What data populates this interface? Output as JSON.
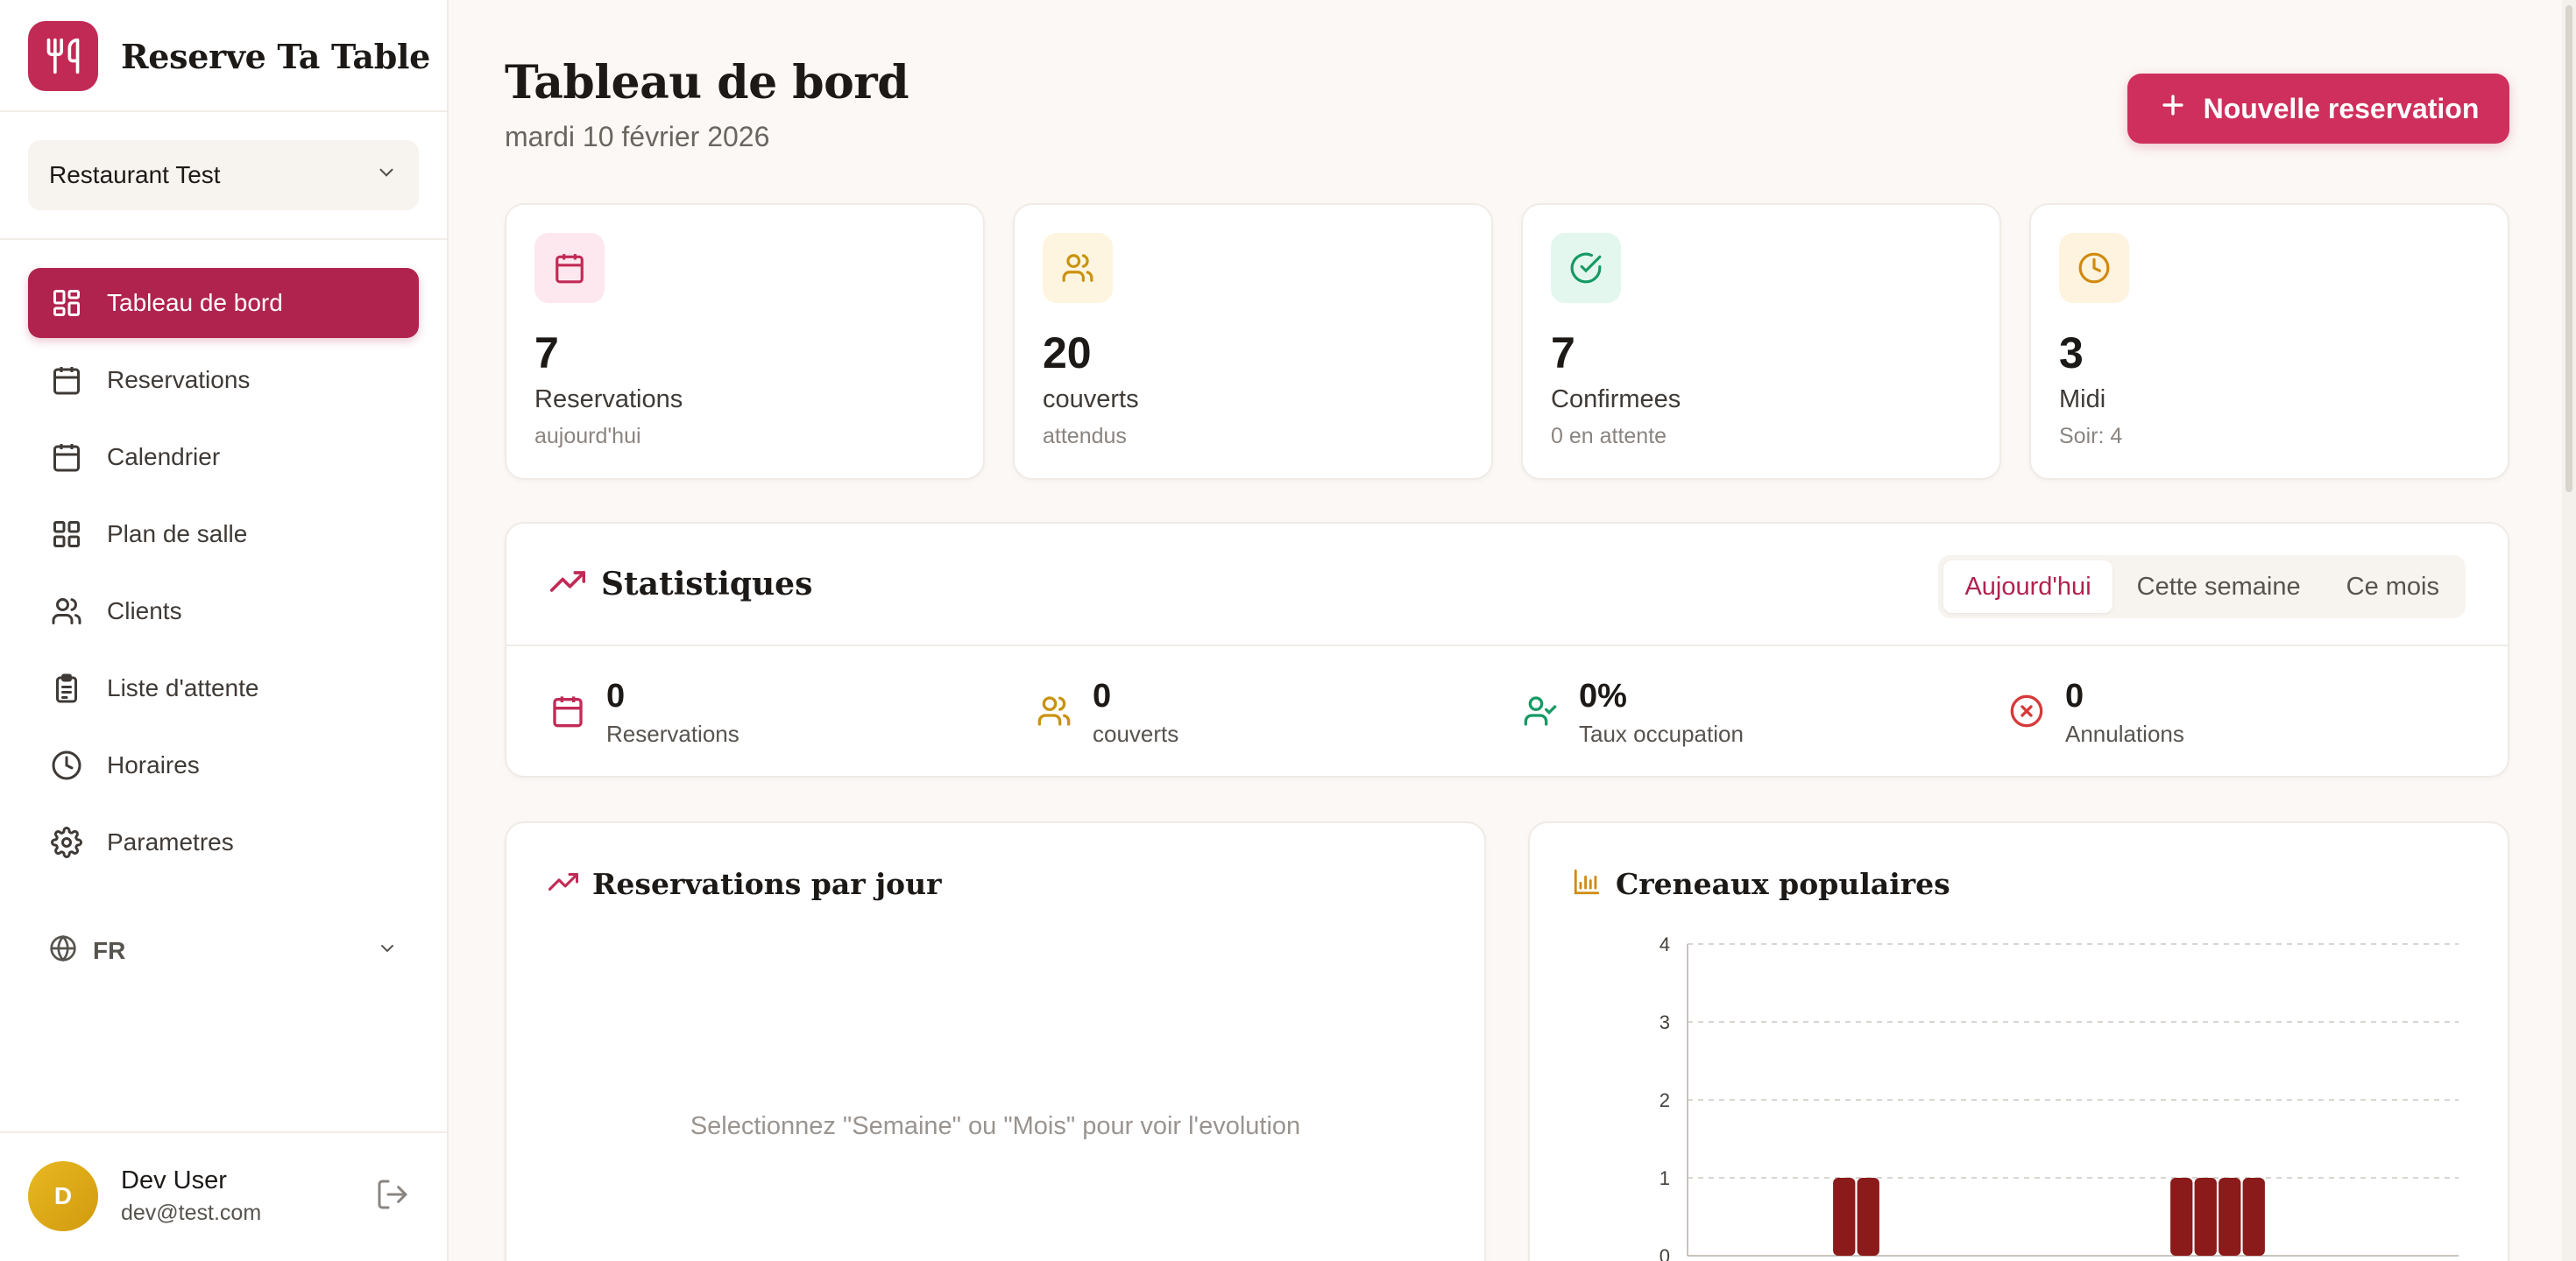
{
  "brand": {
    "name": "Reserve Ta Table"
  },
  "restaurant_select": {
    "value": "Restaurant Test"
  },
  "nav": {
    "items": [
      {
        "label": "Tableau de bord",
        "icon": "dashboard-icon",
        "active": true
      },
      {
        "label": "Reservations",
        "icon": "calendar-icon"
      },
      {
        "label": "Calendrier",
        "icon": "calendar-grid-icon"
      },
      {
        "label": "Plan de salle",
        "icon": "floor-plan-icon"
      },
      {
        "label": "Clients",
        "icon": "users-icon"
      },
      {
        "label": "Liste d'attente",
        "icon": "clipboard-icon"
      },
      {
        "label": "Horaires",
        "icon": "clock-icon"
      },
      {
        "label": "Parametres",
        "icon": "gear-icon"
      }
    ]
  },
  "language": {
    "value": "FR"
  },
  "user": {
    "initial": "D",
    "name": "Dev User",
    "email": "dev@test.com"
  },
  "header": {
    "title": "Tableau de bord",
    "date": "mardi 10 février 2026",
    "new_button": "Nouvelle reservation"
  },
  "kpis": [
    {
      "value": "7",
      "label": "Reservations",
      "sub": "aujourd'hui",
      "icon": "calendar-icon",
      "color": "#C22A56",
      "bg": "#FCE8EE"
    },
    {
      "value": "20",
      "label": "couverts",
      "sub": "attendus",
      "icon": "users-icon",
      "color": "#C99310",
      "bg": "#FDF5DF"
    },
    {
      "value": "7",
      "label": "Confirmees",
      "sub": "0 en attente",
      "icon": "check-circle-icon",
      "color": "#159A64",
      "bg": "#E3F7EE"
    },
    {
      "value": "3",
      "label": "Midi",
      "sub": "Soir: 4",
      "icon": "clock-icon",
      "color": "#D08A0E",
      "bg": "#FDF3DF"
    }
  ],
  "statistics": {
    "title": "Statistiques",
    "tabs": [
      "Aujourd'hui",
      "Cette semaine",
      "Ce mois"
    ],
    "active_tab": "Aujourd'hui",
    "items": [
      {
        "value": "0",
        "label": "Reservations",
        "icon": "calendar-icon",
        "color": "#C22A56"
      },
      {
        "value": "0",
        "label": "couverts",
        "icon": "users-icon",
        "color": "#C99310"
      },
      {
        "value": "0%",
        "label": "Taux occupation",
        "icon": "user-check-icon",
        "color": "#159A64"
      },
      {
        "value": "0",
        "label": "Annulations",
        "icon": "x-circle-icon",
        "color": "#D63A3A"
      }
    ]
  },
  "reservations_per_day": {
    "title": "Reservations par jour",
    "empty_message": "Selectionnez \"Semaine\" ou \"Mois\" pour voir l'evolution"
  },
  "popular_slots": {
    "title": "Creneaux populaires"
  },
  "chart_data": {
    "type": "bar",
    "title": "Creneaux populaires",
    "xlabel": "",
    "ylabel": "",
    "ylim": [
      0,
      4
    ],
    "yticks": [
      "0",
      "1",
      "2",
      "3",
      "4"
    ],
    "grid": true,
    "bar_color": "#8B1A1A",
    "values": [
      0,
      0,
      0,
      0,
      0,
      0,
      1,
      1,
      0,
      0,
      0,
      0,
      0,
      0,
      0,
      0,
      0,
      0,
      0,
      0,
      1,
      1,
      1,
      1,
      0,
      0,
      0,
      0,
      0,
      0,
      0,
      0
    ]
  }
}
